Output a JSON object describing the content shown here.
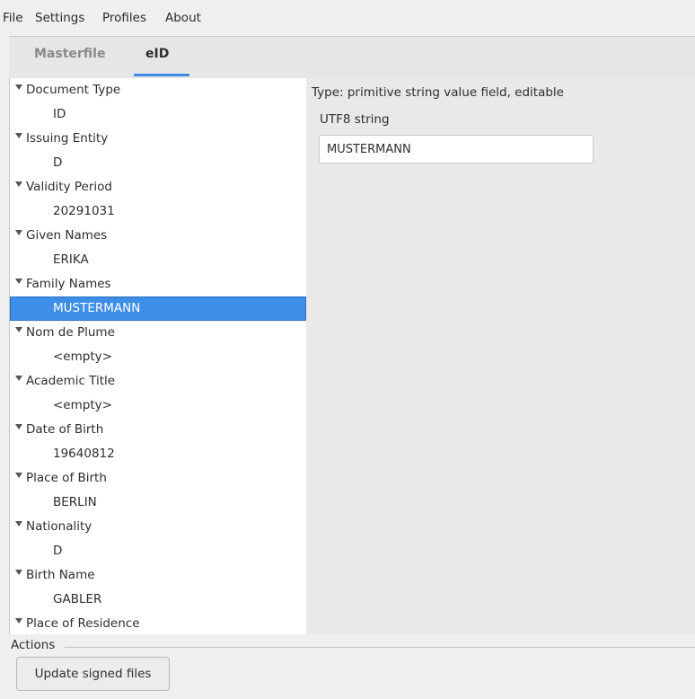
{
  "menubar": {
    "items": [
      "File",
      "Settings",
      "Profiles",
      "About"
    ]
  },
  "tabs": [
    {
      "label": "Masterfile",
      "active": false
    },
    {
      "label": "eID",
      "active": true
    }
  ],
  "tree": {
    "nodes": [
      {
        "label": "Document Type",
        "value": "ID"
      },
      {
        "label": "Issuing Entity",
        "value": "D"
      },
      {
        "label": "Validity Period",
        "value": "20291031"
      },
      {
        "label": "Given Names",
        "value": "ERIKA"
      },
      {
        "label": "Family Names",
        "value": "MUSTERMANN",
        "selected": true
      },
      {
        "label": "Nom de Plume",
        "value": "<empty>"
      },
      {
        "label": "Academic Title",
        "value": "<empty>"
      },
      {
        "label": "Date of Birth",
        "value": "19640812"
      },
      {
        "label": "Place of Birth",
        "value": "BERLIN"
      },
      {
        "label": "Nationality",
        "value": "D"
      },
      {
        "label": "Birth Name",
        "value": "GABLER"
      },
      {
        "label": "Place of Residence",
        "value": ""
      }
    ]
  },
  "detail": {
    "type_text": "Type: primitive string value field, editable",
    "field_label": "UTF8 string",
    "field_value": "MUSTERMANN"
  },
  "actions": {
    "title": "Actions",
    "update_button": "Update signed files"
  },
  "colors": {
    "accent": "#3d8ee6",
    "window_bg": "#efefef",
    "detail_bg": "#e9e9e9"
  }
}
